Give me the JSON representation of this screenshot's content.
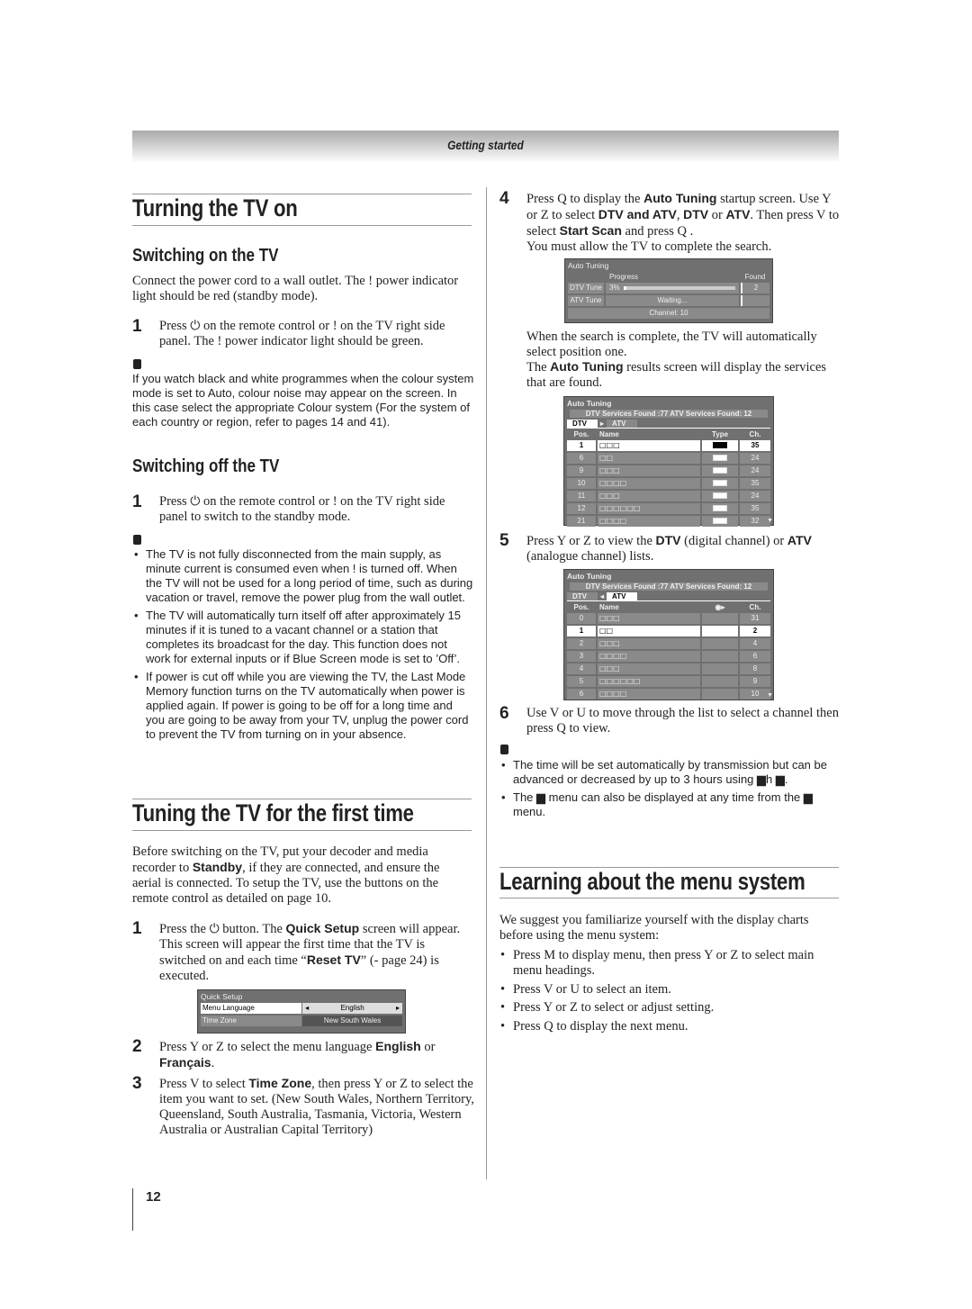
{
  "header": {
    "section": "Getting started"
  },
  "page_number": "12",
  "left": {
    "h_turning": "Turning the TV on",
    "h_switch_on": "Switching on the TV",
    "p_connect": [
      {
        "t": "Connect the power cord to a wall outlet. The !    power indicator light should be red (standby mode)."
      }
    ],
    "step_on_1": [
      {
        "t": "Press "
      },
      {
        "t": "⏻",
        "i": 1
      },
      {
        "t": " on the remote control or !     on the TV right side panel. The !     power indicator light should be green."
      }
    ],
    "note1": "If you watch black and white programmes when the colour system mode is set to Auto, colour noise may appear on the screen. In this case select the appropriate Colour system (For the system of each country or region, refer to pages 14 and 41).",
    "h_switch_off": "Switching off the TV",
    "step_off_1": [
      {
        "t": "Press "
      },
      {
        "t": "⏻",
        "i": 1
      },
      {
        "t": " on the remote control or !     on the TV right side panel to switch to the standby mode."
      }
    ],
    "notes2": [
      "The TV is not fully disconnected from the main supply, as minute current is consumed even when !    is turned off. When the TV will not be used for a long period of time, such as during vacation or travel, remove the power plug from the wall outlet.",
      "The TV will automatically turn itself off after approximately 15 minutes if it is tuned to a vacant channel or a station that completes its broadcast for the day. This function does not work for external inputs or if Blue Screen mode is set to ’Off’.",
      "If power is cut off while you are viewing the TV, the Last Mode Memory function turns on the TV automatically when power is applied again. If power is going to be off for a long time and you are going to be away from your TV, unplug the power cord to prevent the TV from turning on in your absence."
    ],
    "h_tuning": "Tuning the TV for the first time",
    "p_before": [
      {
        "t": "Before switching on the TV, put your decoder and media recorder to "
      },
      {
        "t": "Standby",
        "b": 1
      },
      {
        "t": ", if they are connected, and ensure the aerial is connected. To setup the TV, use the buttons on the remote control as detailed on page 10."
      }
    ],
    "step_t1": [
      {
        "t": "Press the "
      },
      {
        "t": "⏻",
        "i": 1
      },
      {
        "t": " button. The "
      },
      {
        "t": "Quick Setup",
        "b": 1
      },
      {
        "t": " screen will appear. This screen will appear the first time that the TV is switched on and each time “"
      },
      {
        "t": "Reset TV",
        "b": 1
      },
      {
        "t": "” (-    page 24) is executed."
      }
    ],
    "quick_setup": {
      "title": "Quick Setup",
      "rows": [
        {
          "label": "Menu Language",
          "value": "English",
          "selected": true
        },
        {
          "label": "Time Zone",
          "value": "New South Wales",
          "selected": false
        }
      ]
    },
    "step_t2": [
      {
        "t": "Press  Y or  Z to select the menu language "
      },
      {
        "t": "English",
        "b": 1
      },
      {
        "t": " or "
      },
      {
        "t": "Français",
        "b": 1
      },
      {
        "t": "."
      }
    ],
    "step_t3": [
      {
        "t": "Press  V to select "
      },
      {
        "t": "Time Zone",
        "b": 1
      },
      {
        "t": ", then press  Y or  Z to select the item you want to set. (New South Wales, Northern Territory, Queensland, South Australia, Tasmania, Victoria, Western Australia or Australian Capital Territory)"
      }
    ]
  },
  "right": {
    "step4": [
      {
        "t": "Press Q   to display the "
      },
      {
        "t": "Auto Tuning",
        "b": 1
      },
      {
        "t": " startup screen. Use  Y or  Z to select "
      },
      {
        "t": "DTV and ATV",
        "b": 1
      },
      {
        "t": ", "
      },
      {
        "t": "DTV",
        "b": 1
      },
      {
        "t": " or "
      },
      {
        "t": "ATV",
        "b": 1
      },
      {
        "t": ". Then press  V to select "
      },
      {
        "t": "Start Scan",
        "b": 1
      },
      {
        "t": " and press Q  ."
      }
    ],
    "step4_b": "You must allow the TV to complete the search.",
    "progress_osd": {
      "title": "Auto Tuning",
      "col_progress": "Progress",
      "col_found": "Found",
      "dtv_label": "DTV Tune",
      "dtv_percent_text": "3%",
      "dtv_progress": 3,
      "dtv_found": "2",
      "atv_label": "ATV Tune",
      "atv_status": "Waiting...",
      "channel": "Channel: 10"
    },
    "p_complete": "When the search is complete, the TV will automatically select position one.",
    "p_results": [
      {
        "t": "The "
      },
      {
        "t": "Auto Tuning",
        "b": 1
      },
      {
        "t": " results screen will display the services that are found."
      }
    ],
    "dtv_osd": {
      "title": "Auto Tuning",
      "summary": "DTV Services Found :77    ATV Services Found: 12",
      "tab_dtv": "DTV",
      "tab_atv": "ATV",
      "active_tab": "DTV",
      "headers": [
        "Pos.",
        "Name",
        "Type",
        "Ch."
      ],
      "rows": [
        {
          "pos": "1",
          "name": "□□□",
          "ch": "35",
          "sel": true
        },
        {
          "pos": "6",
          "name": "□□",
          "ch": "24"
        },
        {
          "pos": "9",
          "name": "□□□",
          "ch": "24"
        },
        {
          "pos": "10",
          "name": "□□□□",
          "ch": "35"
        },
        {
          "pos": "11",
          "name": "□□□",
          "ch": "24"
        },
        {
          "pos": "12",
          "name": "□□□□□□",
          "ch": "35"
        },
        {
          "pos": "21",
          "name": "□□□□",
          "ch": "32"
        }
      ]
    },
    "step5": [
      {
        "t": "Press  Y or  Z to view the "
      },
      {
        "t": "DTV",
        "b": 1
      },
      {
        "t": " (digital channel) or "
      },
      {
        "t": "ATV",
        "b": 1
      },
      {
        "t": " (analogue channel) lists."
      }
    ],
    "atv_osd": {
      "title": "Auto Tuning",
      "summary": "DTV Services Found :77    ATV Services Found: 12",
      "tab_dtv": "DTV",
      "tab_atv": "ATV",
      "active_tab": "ATV",
      "headers": [
        "Pos.",
        "Name",
        "◉▸",
        "Ch."
      ],
      "rows": [
        {
          "pos": "0",
          "name": "□□□",
          "ch": "31"
        },
        {
          "pos": "1",
          "name": "□□",
          "ch": "2",
          "sel": true
        },
        {
          "pos": "2",
          "name": "□□□",
          "ch": "4"
        },
        {
          "pos": "3",
          "name": "□□□□",
          "ch": "6"
        },
        {
          "pos": "4",
          "name": "□□□",
          "ch": "8"
        },
        {
          "pos": "5",
          "name": "□□□□□□",
          "ch": "9"
        },
        {
          "pos": "6",
          "name": "□□□□",
          "ch": "10"
        }
      ]
    },
    "step6": "Use  V or  U to move through the list to select a channel then press Q   to view.",
    "notes3": [
      "The time will be set automatically by transmission but can be advanced or decreased by up to 3 hours using  ▆h ▆.",
      "The ▆               menu can also be displayed at any time from the ▆          menu."
    ],
    "h_learning": "Learning about the menu system",
    "p_suggest": "We suggest you familiarize yourself with the display charts before using the menu system:",
    "menu_bullets": [
      "Press M   to display menu, then press  Y or  Z to select main menu headings.",
      "Press  V or  U to select an item.",
      "Press  Y or  Z to select or adjust setting.",
      "Press Q   to display the next menu."
    ]
  }
}
